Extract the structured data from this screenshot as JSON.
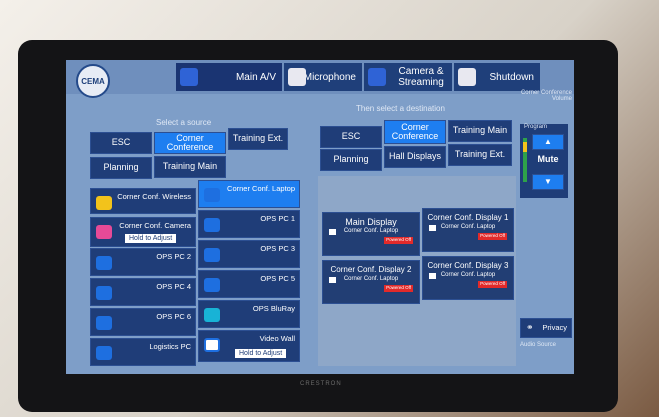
{
  "header": {
    "logo_text": "CEMA",
    "tabs": [
      {
        "label": "Main A/V"
      },
      {
        "label": "Microphone"
      },
      {
        "label": "Camera & Streaming"
      },
      {
        "label": "Shutdown"
      }
    ]
  },
  "source": {
    "caption": "Select a source",
    "rooms": [
      "ESC",
      "Corner Conference",
      "Training Ext.",
      "Planning",
      "Training Main"
    ],
    "items": [
      {
        "label": "Corner Conf. Wireless"
      },
      {
        "label": "Corner Conf. Laptop"
      },
      {
        "label": "Corner Conf. Camera",
        "hold": "Hold to Adjust"
      },
      {
        "label": "OPS PC 1"
      },
      {
        "label": "OPS PC 2"
      },
      {
        "label": "OPS PC 3"
      },
      {
        "label": "OPS PC 4"
      },
      {
        "label": "OPS PC 5"
      },
      {
        "label": "OPS PC 6"
      },
      {
        "label": "OPS BluRay"
      },
      {
        "label": "Logistics PC"
      },
      {
        "label": "Video Wall",
        "hold": "Hold to Adjust"
      }
    ]
  },
  "destination": {
    "caption": "Then select a destination",
    "rooms": [
      "ESC",
      "Corner Conference",
      "Training Main",
      "Planning",
      "Hall Displays",
      "Training Ext."
    ],
    "displays": [
      {
        "title": "Main Display",
        "sub": "Corner Conf. Laptop",
        "status": "Powered Off"
      },
      {
        "title": "Corner Conf. Display 1",
        "sub": "Corner Conf. Laptop",
        "status": "Powered Off"
      },
      {
        "title": "Corner Conf. Display 2",
        "sub": "Corner Conf. Laptop",
        "status": "Powered Off"
      },
      {
        "title": "Corner Conf. Display 3",
        "sub": "Corner Conf. Laptop",
        "status": "Powered Off"
      }
    ]
  },
  "volume": {
    "title": "Corner Conference Volume",
    "program_label": "Program",
    "mute_label": "Mute",
    "privacy_label": "Privacy",
    "audio_source_label": "Audio Source"
  },
  "device": {
    "brand": "CRESTRON"
  },
  "colors": {
    "accent": "#1e7ef0",
    "button": "#1f3d78",
    "panel": "#7e9ec8",
    "power_off": "#e22a2a"
  }
}
